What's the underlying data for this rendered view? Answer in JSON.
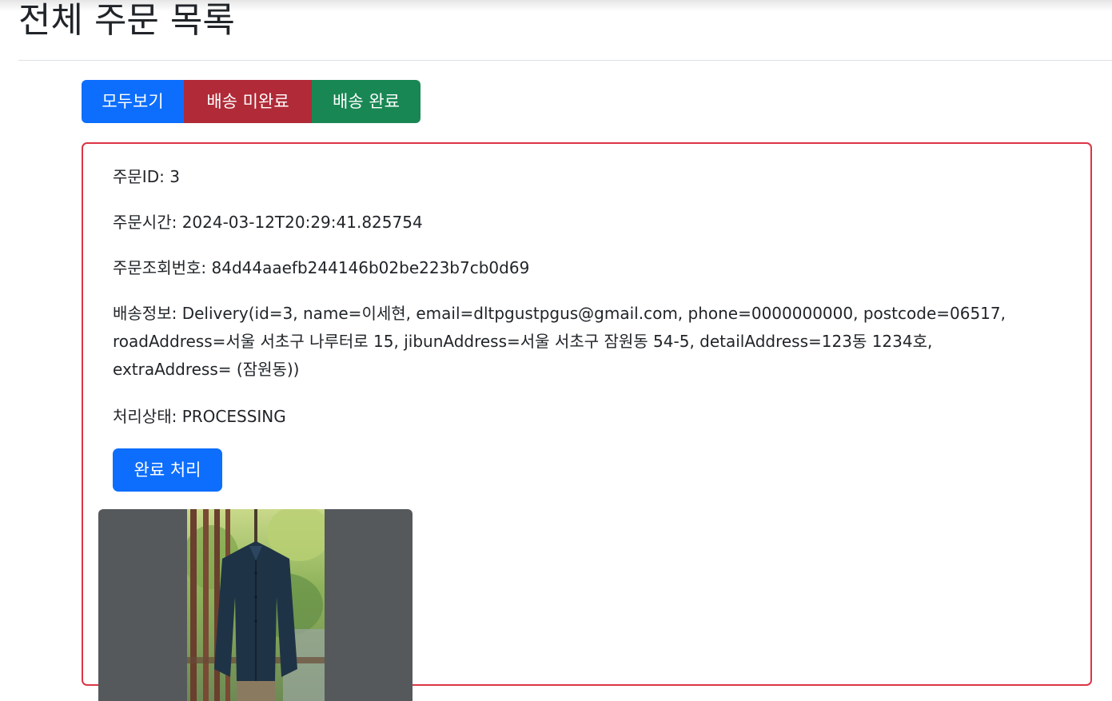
{
  "page": {
    "title": "전체 주문 목록"
  },
  "filters": {
    "all_label": "모두보기",
    "pending_label": "배송 미완료",
    "done_label": "배송 완료"
  },
  "order": {
    "id_text": "주문ID: 3",
    "time_text": "주문시간: 2024-03-12T20:29:41.825754",
    "lookup_text": "주문조회번호: 84d44aaefb244146b02be223b7cb0d69",
    "delivery_line1": "배송정보: Delivery(id=3, name=이세현, email=dltpgustpgus@gmail.com, phone=0000000000, postcode=06517,",
    "delivery_line2": "roadAddress=서울 서초구 나루터로 15, jibunAddress=서울 서초구 잠원동 54-5, detailAddress=123동 1234호,",
    "delivery_line3": "extraAddress= (잠원동))",
    "status_text": "처리상태: PROCESSING",
    "complete_button_label": "완료 처리"
  },
  "product": {
    "image_description": "jacket-photo"
  },
  "colors": {
    "primary": "#0d6efd",
    "danger": "#b02a37",
    "success": "#198754",
    "card_border": "#dc3545",
    "image_bg": "#55595c"
  }
}
